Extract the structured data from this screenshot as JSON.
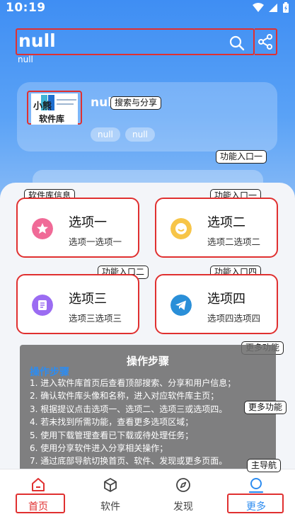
{
  "status_bar": {
    "time": "10:19"
  },
  "header": {
    "title": "null",
    "subtitle": "null"
  },
  "profile": {
    "app_name": "null",
    "tags": [
      "null",
      "null"
    ],
    "logo_text_top": "小熊",
    "logo_text_bottom": "软件库"
  },
  "callouts": {
    "search_share": "搜索与分享",
    "feature_entry_1_top": "功能入口一",
    "library_info": "软件库信息",
    "feature_entry_1": "功能入口一",
    "feature_entry_2": "功能入口二",
    "feature_entry_4": "功能入口四",
    "more_features_1": "更多功能",
    "more_features_2": "更多功能",
    "main_nav": "主导航"
  },
  "options": [
    {
      "title": "选项一",
      "subtitle": "选项一选项一",
      "icon": "star-icon",
      "color": "#e8477e"
    },
    {
      "title": "选项二",
      "subtitle": "选项二选项二",
      "icon": "chat-icon",
      "color": "#f3b53a"
    },
    {
      "title": "选项三",
      "subtitle": "选项三选项三",
      "icon": "document-icon",
      "color": "#8b5cf6"
    },
    {
      "title": "选项四",
      "subtitle": "选项四选项四",
      "icon": "telegram-icon",
      "color": "#2a8fd8"
    }
  ],
  "instructions": {
    "title": "操作步骤",
    "heading": "操作步骤",
    "steps": [
      "1. 进入软件库首页后查看顶部搜索、分享和用户信息；",
      "2. 确认软件库头像和名称，进入对应软件库主页；",
      "3. 根据提议点击选项一、选项二、选项三或选项四。",
      "4. 若未找到所需功能，查看更多选项区域；",
      "5. 使用下载管理查看已下载或待处理任务；",
      "6. 使用分享软件进入分享相关操作；",
      "7. 通过底部导航切换首页、软件、发现或更多页面。"
    ]
  },
  "bottom_nav": [
    {
      "label": "首页",
      "icon": "home-icon",
      "active": true
    },
    {
      "label": "软件",
      "icon": "cube-icon",
      "active": false
    },
    {
      "label": "发现",
      "icon": "compass-icon",
      "active": false
    },
    {
      "label": "更多",
      "icon": "person-icon",
      "active": true
    }
  ],
  "colors": {
    "brand": "#3f8ef3",
    "highlight": "#e03030",
    "active_nav": "#2d8cf0"
  }
}
